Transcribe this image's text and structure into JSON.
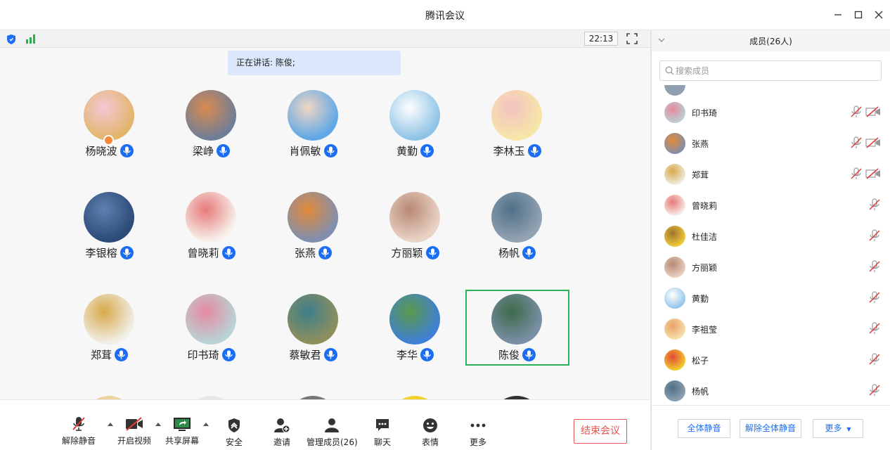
{
  "window": {
    "title": "腾讯会议"
  },
  "status": {
    "clock": "22:13"
  },
  "speaking": {
    "label": "正在讲话: 陈俊;"
  },
  "participants": [
    {
      "name": "杨晓波",
      "host": true,
      "color1": "#e2b56b",
      "color2": "#f3c8d5"
    },
    {
      "name": "梁峥",
      "color1": "#6f7e98",
      "color2": "#d98a4f"
    },
    {
      "name": "肖佩敏",
      "color1": "#5ea8e6",
      "color2": "#f1d6c4"
    },
    {
      "name": "黄勤",
      "color1": "#8fc3e6",
      "color2": "#ffffff"
    },
    {
      "name": "李林玉",
      "color1": "#f6e6a8",
      "color2": "#f4c2c2"
    },
    {
      "name": "李银榕",
      "color1": "#2c4a78",
      "color2": "#5f7fae"
    },
    {
      "name": "曾晓莉",
      "color1": "#f7f0ea",
      "color2": "#e77a7a"
    },
    {
      "name": "张燕",
      "color1": "#7f8fb0",
      "color2": "#e38a3a"
    },
    {
      "name": "方丽颖",
      "color1": "#e9d3c7",
      "color2": "#b98973"
    },
    {
      "name": "杨帆",
      "color1": "#93a3b3",
      "color2": "#4f6f86"
    },
    {
      "name": "郑茸",
      "color1": "#f1eee6",
      "color2": "#d7a94a"
    },
    {
      "name": "印书琦",
      "color1": "#b9d3d6",
      "color2": "#e58aa0"
    },
    {
      "name": "蔡敏君",
      "color1": "#8f8f5e",
      "color2": "#3d7e8a"
    },
    {
      "name": "李华",
      "color1": "#3f7fd6",
      "color2": "#5a9a4a"
    },
    {
      "name": "陈俊",
      "speaking": true,
      "color1": "#7a8fa6",
      "color2": "#3d6a4a"
    }
  ],
  "toolbar": {
    "unmute": "解除静音",
    "video": "开启视频",
    "share": "共享屏幕",
    "security": "安全",
    "invite": "邀请",
    "manage": "管理成员(26)",
    "chat": "聊天",
    "reaction": "表情",
    "more": "更多",
    "end": "结束会议"
  },
  "panel": {
    "title": "成员(26人)",
    "search_placeholder": "搜索成员",
    "members": [
      {
        "name": "印书琦",
        "video": true,
        "color1": "#b9d3d6",
        "color2": "#e58aa0"
      },
      {
        "name": "张燕",
        "video": true,
        "color1": "#7f8fb0",
        "color2": "#e38a3a"
      },
      {
        "name": "郑茸",
        "video": true,
        "color1": "#f1eee6",
        "color2": "#d7a94a"
      },
      {
        "name": "曾晓莉",
        "video": false,
        "color1": "#f7f0ea",
        "color2": "#e77a7a"
      },
      {
        "name": "杜佳洁",
        "video": false,
        "color1": "#f2cf3a",
        "color2": "#a0742e"
      },
      {
        "name": "方丽颖",
        "video": false,
        "color1": "#e9d3c7",
        "color2": "#b98973"
      },
      {
        "name": "黄勤",
        "video": false,
        "color1": "#8fc3e6",
        "color2": "#ffffff"
      },
      {
        "name": "李祖莹",
        "video": false,
        "color1": "#f6e2b0",
        "color2": "#e9a36a"
      },
      {
        "name": "松子",
        "video": false,
        "color1": "#f2d12c",
        "color2": "#e44a3a"
      },
      {
        "name": "杨帆",
        "video": false,
        "color1": "#93a3b3",
        "color2": "#4f6f86"
      }
    ],
    "mute_all": "全体静音",
    "unmute_all": "解除全体静音",
    "more": "更多"
  }
}
